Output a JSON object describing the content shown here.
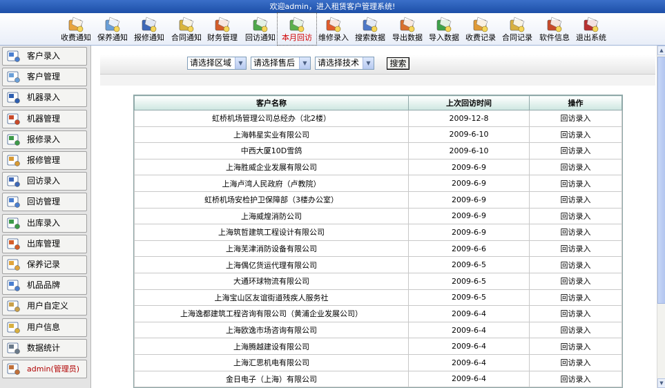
{
  "window": {
    "title": "欢迎admin，进入租赁客户管理系统!"
  },
  "toolbar": {
    "items": [
      {
        "label": "收费通知",
        "icon": "fee-notice-icon"
      },
      {
        "label": "保养通知",
        "icon": "maintenance-notice-icon"
      },
      {
        "label": "报修通知",
        "icon": "repair-notice-icon"
      },
      {
        "label": "合同通知",
        "icon": "contract-notice-icon"
      },
      {
        "label": "财务管理",
        "icon": "finance-icon"
      },
      {
        "label": "回访通知",
        "icon": "revisit-notice-icon"
      },
      {
        "label": "本月回访",
        "icon": "monthly-revisit-icon",
        "active": true
      },
      {
        "label": "维修录入",
        "icon": "repair-entry-icon"
      },
      {
        "label": "搜索数据",
        "icon": "search-data-icon"
      },
      {
        "label": "导出数据",
        "icon": "export-data-icon"
      },
      {
        "label": "导入数据",
        "icon": "import-data-icon"
      },
      {
        "label": "收费记录",
        "icon": "fee-record-icon"
      },
      {
        "label": "合同记录",
        "icon": "contract-record-icon"
      },
      {
        "label": "软件信息",
        "icon": "software-info-icon"
      },
      {
        "label": "退出系统",
        "icon": "exit-icon"
      }
    ]
  },
  "sidebar": {
    "items": [
      {
        "label": "客户录入",
        "icon": "customer-entry-icon"
      },
      {
        "label": "客户管理",
        "icon": "customer-manage-icon"
      },
      {
        "label": "机器录入",
        "icon": "machine-entry-icon"
      },
      {
        "label": "机器管理",
        "icon": "machine-manage-icon"
      },
      {
        "label": "报修录入",
        "icon": "repair-entry-icon"
      },
      {
        "label": "报修管理",
        "icon": "repair-manage-icon"
      },
      {
        "label": "回访录入",
        "icon": "revisit-entry-icon"
      },
      {
        "label": "回访管理",
        "icon": "revisit-manage-icon"
      },
      {
        "label": "出库录入",
        "icon": "outbound-entry-icon"
      },
      {
        "label": "出库管理",
        "icon": "outbound-manage-icon"
      },
      {
        "label": "保养记录",
        "icon": "maintenance-record-icon"
      },
      {
        "label": "机品品牌",
        "icon": "brand-icon"
      },
      {
        "label": "用户自定义",
        "icon": "user-custom-icon"
      },
      {
        "label": "用户信息",
        "icon": "user-info-icon"
      },
      {
        "label": "数据统计",
        "icon": "statistics-icon"
      },
      {
        "label": "admin(管理员)",
        "icon": "home-icon"
      }
    ]
  },
  "filters": {
    "region": "请选择区域",
    "after_sales": "请选择售后",
    "technician": "请选择技术",
    "search_label": "搜索"
  },
  "table": {
    "headers": [
      "客户名称",
      "上次回访时间",
      "操作"
    ],
    "rows": [
      [
        "虹桥机场管理公司总经办（北2楼）",
        "2009-12-8",
        "回访录入"
      ],
      [
        "上海韩星实业有限公司",
        "2009-6-10",
        "回访录入"
      ],
      [
        "中西大厦10D雪鸽",
        "2009-6-10",
        "回访录入"
      ],
      [
        "上海胜威企业发展有限公司",
        "2009-6-9",
        "回访录入"
      ],
      [
        "上海卢湾人民政府（卢教院）",
        "2009-6-9",
        "回访录入"
      ],
      [
        "虹桥机场安检护卫保障部（3楼办公室）",
        "2009-6-9",
        "回访录入"
      ],
      [
        "上海威煌消防公司",
        "2009-6-9",
        "回访录入"
      ],
      [
        "上海筑哲建筑工程设计有限公司",
        "2009-6-9",
        "回访录入"
      ],
      [
        "上海芜津消防设备有限公司",
        "2009-6-6",
        "回访录入"
      ],
      [
        "上海偶亿货运代理有限公司",
        "2009-6-5",
        "回访录入"
      ],
      [
        "大通环球物流有限公司",
        "2009-6-5",
        "回访录入"
      ],
      [
        "上海宝山区友谊街道残疾人服务社",
        "2009-6-5",
        "回访录入"
      ],
      [
        "上海逸都建筑工程咨询有限公司（黄浦企业发展公司）",
        "2009-6-4",
        "回访录入"
      ],
      [
        "上海欧逸市场咨询有限公司",
        "2009-6-4",
        "回访录入"
      ],
      [
        "上海腾越建设有限公司",
        "2009-6-4",
        "回访录入"
      ],
      [
        "上海汇思机电有限公司",
        "2009-6-4",
        "回访录入"
      ],
      [
        "金日电子（上海）有限公司",
        "2009-6-4",
        "回访录入"
      ]
    ]
  }
}
